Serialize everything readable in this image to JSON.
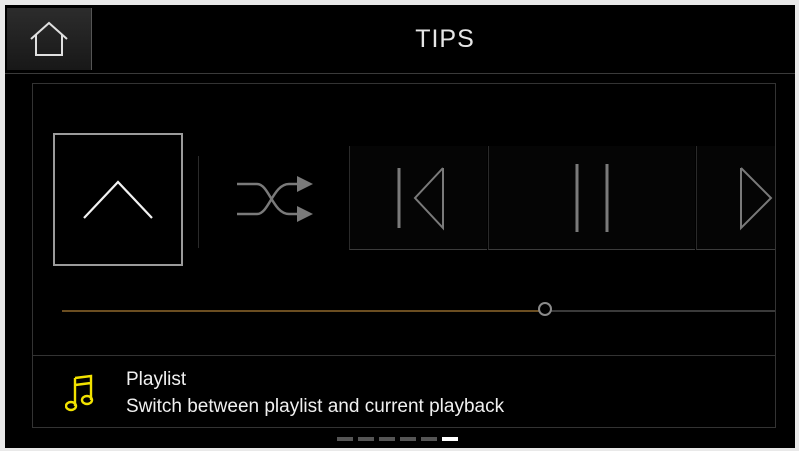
{
  "header": {
    "title": "TIPS",
    "home_icon": "home-icon"
  },
  "tip": {
    "icon": "music-note-icon",
    "icon_color": "#f2e200",
    "title": "Playlist",
    "description": "Switch between playlist and current playback"
  },
  "preview": {
    "controls": [
      "up-icon",
      "shuffle-icon",
      "previous-icon",
      "pause-icon",
      "next-icon"
    ],
    "progress_fraction": 0.678,
    "progress_color": "#6b4e21"
  },
  "pager": {
    "total": 6,
    "active_index": 5
  }
}
